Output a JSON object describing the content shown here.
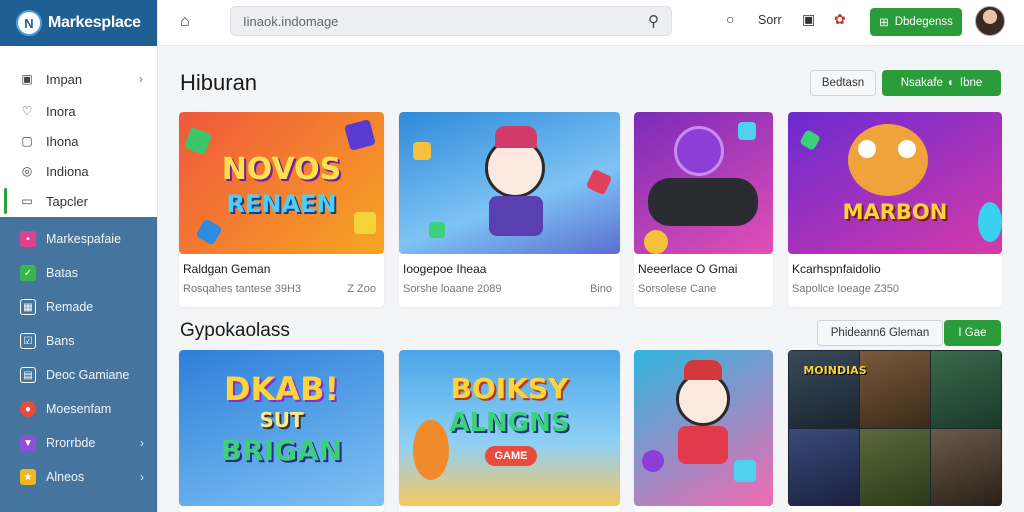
{
  "brand": {
    "name": "Markesplace",
    "logo_letter": "N"
  },
  "sidebar": {
    "items": [
      {
        "label": "Impan",
        "icon": "image-icon",
        "has_chevron": true
      },
      {
        "label": "Inora",
        "icon": "heart-icon",
        "has_chevron": false
      },
      {
        "label": "Ihona",
        "icon": "box-icon",
        "has_chevron": false
      },
      {
        "label": "Indiona",
        "icon": "circle-icon",
        "has_chevron": false
      },
      {
        "label": "Tapcler",
        "icon": "tag-icon",
        "has_chevron": false,
        "active": true
      }
    ],
    "dark_items": [
      {
        "label": "Markespafaie",
        "icon": "store-icon",
        "has_chevron": false
      },
      {
        "label": "Batas",
        "icon": "check-icon",
        "has_chevron": false
      },
      {
        "label": "Remade",
        "icon": "grid-icon",
        "has_chevron": false
      },
      {
        "label": "Bans",
        "icon": "box-check-icon",
        "has_chevron": false
      },
      {
        "label": "Deoc Gamiane",
        "icon": "chat-icon",
        "has_chevron": false
      },
      {
        "label": "Moesenfam",
        "icon": "globe-icon",
        "has_chevron": false
      },
      {
        "label": "Rrorrbde",
        "icon": "shield-icon",
        "has_chevron": true
      },
      {
        "label": "Alneos",
        "icon": "star-icon",
        "has_chevron": true
      }
    ]
  },
  "topbar": {
    "search_placeholder": "Iinaok.indomage",
    "sort_label": "Sorr",
    "cta_label": "Dbdegenss"
  },
  "section1": {
    "title": "Hiburan",
    "outline_button": "Bedtasn",
    "green_button": "Nsakafe",
    "green_button_extra": "Ibne",
    "cards": [
      {
        "title": "Raldgan Geman",
        "meta": "Rosqahes  tantese 39H3",
        "meta_right": "Z Zoo",
        "art_text": "NOVOS",
        "art_sub": "RENAEN",
        "bg1": "#f0573c",
        "bg2": "#f6a623"
      },
      {
        "title": "Ioogepoe Iheaa",
        "meta": "Sorshe  loaane 2089",
        "meta_right": "Bino",
        "art_text": "",
        "art_sub": "",
        "bg1": "#2f8ad8",
        "bg2": "#7ec3f5"
      },
      {
        "title": "Neeerlace O Gmai",
        "meta": "Sorsolese  Cane",
        "meta_right": "",
        "art_text": "",
        "art_sub": "",
        "bg1": "#7a2bb8",
        "bg2": "#e24fb6"
      },
      {
        "title": "Kcarhspnfaidolio",
        "meta": "Sapollce  Ioeage  Z350",
        "meta_right": "",
        "art_text": "MARBON",
        "art_sub": "",
        "bg1": "#6a2ad0",
        "bg2": "#d63aa9"
      }
    ]
  },
  "section2": {
    "title": "Gypokaolass",
    "outline_button": "Phideann6 Gleman",
    "green_button": "I Gae",
    "cards": [
      {
        "art_text": "DKAB!",
        "art_mid": "SUT",
        "art_sub": "BRIGAN",
        "bg1": "#2e7fd9",
        "bg2": "#7fc2f4"
      },
      {
        "art_text": "BOIKSY",
        "art_mid": "",
        "art_sub": "ALNGNS",
        "badge": "GAME",
        "bg1": "#4aa6e8",
        "bg2": "#f6c85f"
      },
      {
        "art_text": "",
        "art_mid": "",
        "art_sub": "",
        "bg1": "#2fb7e0",
        "bg2": "#f06bb0"
      },
      {
        "art_text": "MOINDIAS",
        "art_mid": "",
        "art_sub": "",
        "bg1": "#2b3b4f",
        "bg2": "#7d5c3a"
      }
    ]
  }
}
